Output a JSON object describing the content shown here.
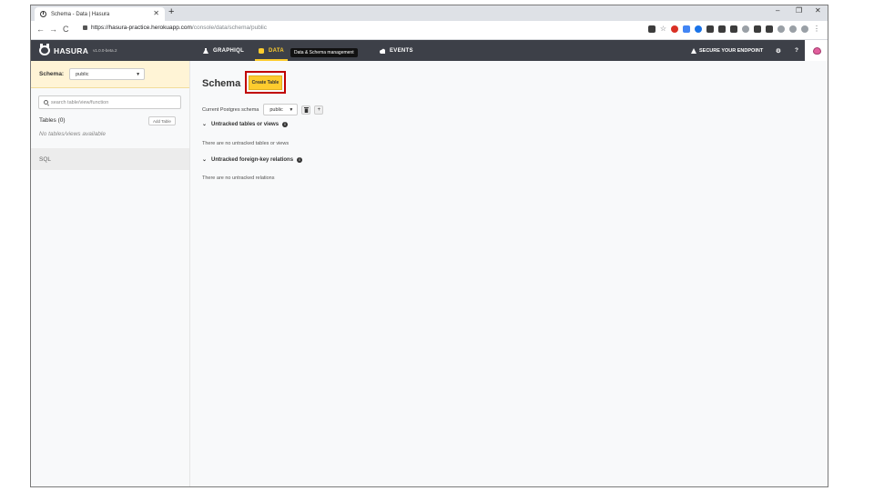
{
  "browser": {
    "tab_title": "Schema - Data | Hasura",
    "tab_close": "✕",
    "new_tab": "+",
    "url_host": "https://hasura-practice.herokuapp.com",
    "url_path": "/console/data/schema/public",
    "back": "←",
    "forward": "→",
    "reload": "C",
    "minimize": "–",
    "restore": "❐",
    "close": "✕",
    "star": "☆",
    "menu": "⋮"
  },
  "header": {
    "brand": "HASURA",
    "version": "v1.0.0-beta.2",
    "nav": [
      {
        "label": "GRAPHIQL"
      },
      {
        "label": "DATA"
      },
      {
        "label": "EVENTS"
      }
    ],
    "tooltip": "Data & Schema management",
    "secure_label": "SECURE YOUR ENDPOINT",
    "settings_icon": "⚙",
    "help_icon": "?"
  },
  "sidebar": {
    "schema_label": "Schema:",
    "schema_value": "public",
    "search_placeholder": "search table/view/function",
    "tables_heading": "Tables (0)",
    "add_table": "Add Table",
    "empty_text": "No tables/views available",
    "sql_label": "SQL"
  },
  "main": {
    "title": "Schema",
    "create_table": "Create Table",
    "current_schema_label": "Current Postgres schema",
    "current_schema_value": "public",
    "delete_icon": "🗑",
    "add_icon": "+",
    "sections": [
      {
        "heading": "Untracked tables or views",
        "body": "There are no untracked tables or views"
      },
      {
        "heading": "Untracked foreign-key relations",
        "body": "There are no untracked relations"
      }
    ]
  },
  "colors": {
    "header_bg": "#3d4048",
    "accent_yellow": "#fdcc2e",
    "highlight_red": "#c00000",
    "schema_bar_bg": "#fff4d6"
  }
}
